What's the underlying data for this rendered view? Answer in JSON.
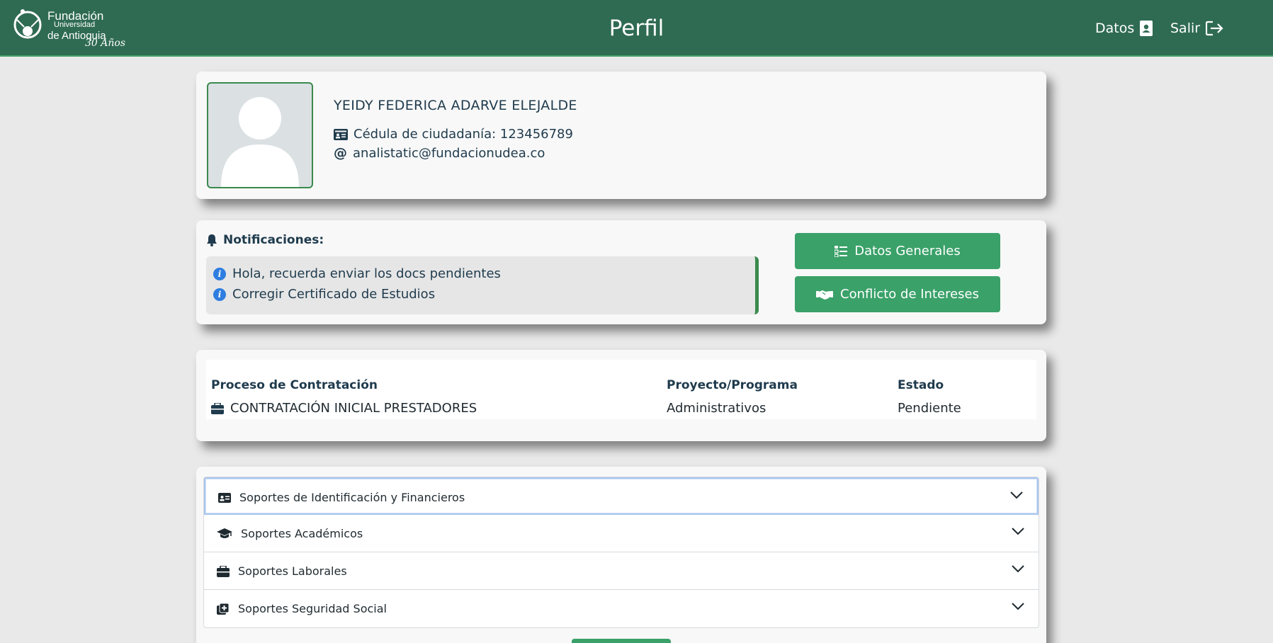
{
  "header": {
    "logo": {
      "line1": "Fundación",
      "line2": "Universidad",
      "line3": "de Antioquia",
      "line4": "30 Años"
    },
    "title": "Perfil",
    "nav": {
      "datos_label": "Datos",
      "salir_label": "Salir"
    }
  },
  "profile": {
    "name": "YEIDY FEDERICA ADARVE ELEJALDE",
    "id_text": "Cédula de ciudadanía: 123456789",
    "email": "analistatic@fundacionudea.co"
  },
  "notifications": {
    "title": "Notificaciones:",
    "items": [
      "Hola, recuerda enviar los docs pendientes",
      "Corregir Certificado de Estudios"
    ],
    "buttons": {
      "datos_generales": "Datos Generales",
      "conflicto": "Conflicto de Intereses"
    }
  },
  "contract_table": {
    "headers": [
      "Proceso de Contratación",
      "Proyecto/Programa",
      "Estado"
    ],
    "rows": [
      [
        "CONTRATACIÓN INICIAL PRESTADORES",
        "Administrativos",
        "Pendiente"
      ]
    ]
  },
  "accordion": {
    "items": [
      {
        "label": "Soportes de Identificación y Financieros",
        "icon": "id-card-icon"
      },
      {
        "label": "Soportes Académicos",
        "icon": "graduation-cap-icon"
      },
      {
        "label": "Soportes Laborales",
        "icon": "briefcase-icon"
      },
      {
        "label": "Soportes Seguridad Social",
        "icon": "medical-file-icon"
      }
    ]
  },
  "colors": {
    "header_bg": "#2f6b53",
    "accent_green": "#3aa169",
    "border_green": "#3a8a4e",
    "info_blue": "#2e7de0",
    "page_bg": "#e9e9e9"
  }
}
